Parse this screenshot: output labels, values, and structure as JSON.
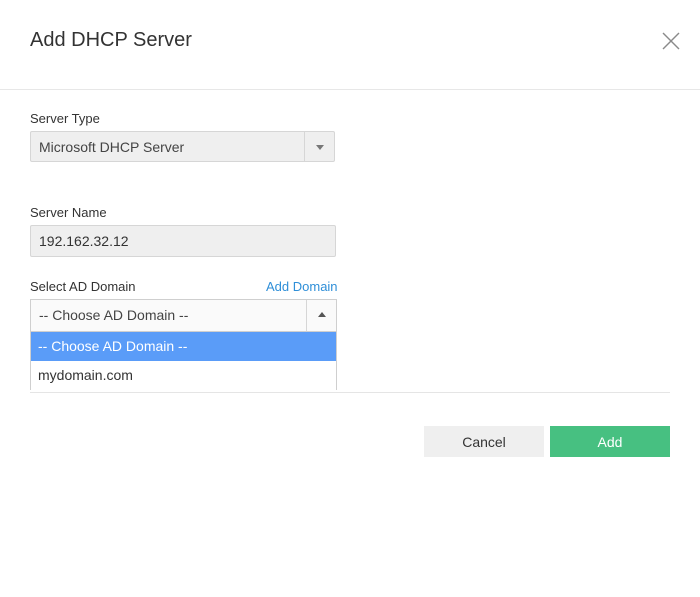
{
  "dialog": {
    "title": "Add DHCP Server"
  },
  "server_type": {
    "label": "Server Type",
    "selected": "Microsoft DHCP Server"
  },
  "server_name": {
    "label": "Server Name",
    "value": "192.162.32.12"
  },
  "ad_domain": {
    "label": "Select AD Domain",
    "add_link": "Add Domain",
    "selected": "-- Choose AD Domain --",
    "options": [
      "-- Choose AD Domain --",
      "mydomain.com"
    ]
  },
  "actions": {
    "cancel_label": "Cancel",
    "add_label": "Add"
  },
  "colors": {
    "accent_green": "#47c081",
    "link_blue": "#2f8fd8",
    "option_highlight": "#5a9cf8"
  },
  "icons": {
    "close": "close-icon",
    "server_type_arrow": "caret-down-icon",
    "ad_domain_arrow": "caret-up-icon"
  }
}
